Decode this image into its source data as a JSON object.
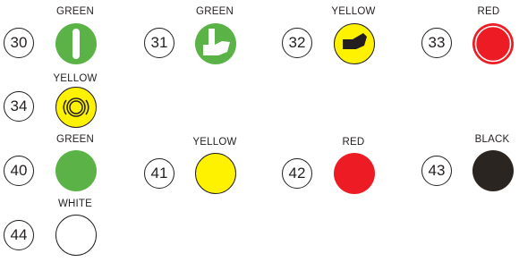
{
  "items": [
    {
      "number": "30",
      "color_label": "GREEN",
      "color": "#5bb348",
      "symbol": "bar-icon"
    },
    {
      "number": "31",
      "color_label": "GREEN",
      "color": "#5bb348",
      "symbol": "hand-on-button-icon"
    },
    {
      "number": "32",
      "color_label": "YELLOW",
      "color": "#fff200",
      "symbol": "hand-press-icon"
    },
    {
      "number": "33",
      "color_label": "RED",
      "color": "#ed1c24",
      "symbol": "ring-icon"
    },
    {
      "number": "34",
      "color_label": "YELLOW",
      "color": "#fff200",
      "symbol": "concentric-rings-icon"
    },
    {
      "number": "40",
      "color_label": "GREEN",
      "color": "#5bb348",
      "symbol": "plain-icon"
    },
    {
      "number": "41",
      "color_label": "YELLOW",
      "color": "#fff200",
      "symbol": "plain-icon"
    },
    {
      "number": "42",
      "color_label": "RED",
      "color": "#ed1c24",
      "symbol": "plain-icon"
    },
    {
      "number": "43",
      "color_label": "BLACK",
      "color": "#2b2522",
      "symbol": "plain-icon"
    },
    {
      "number": "44",
      "color_label": "WHITE",
      "color": "#ffffff",
      "symbol": "plain-icon"
    }
  ]
}
